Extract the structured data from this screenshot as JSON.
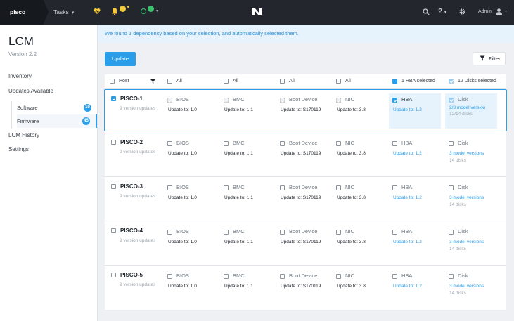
{
  "topbar": {
    "cluster_name": "pisco",
    "tasks_label": "Tasks",
    "help_label": "?",
    "admin_label": "Admin"
  },
  "sidebar": {
    "title": "LCM",
    "version": "Version 2.2",
    "items": [
      {
        "label": "Inventory"
      },
      {
        "label": "Updates Available"
      },
      {
        "label": "LCM History"
      },
      {
        "label": "Settings"
      }
    ],
    "subitems": [
      {
        "label": "Software",
        "badge": "10",
        "active": false
      },
      {
        "label": "Firmware",
        "badge": "45",
        "active": true
      }
    ]
  },
  "banner": {
    "text": "We found 1 dependency based on your selection, and automatically selected them."
  },
  "toolbar": {
    "update_label": "Update",
    "filter_label": "Filter"
  },
  "table": {
    "headers": {
      "host": "Host",
      "bios": "All",
      "bmc": "All",
      "boot": "All",
      "nic": "All",
      "hba": "1 HBA selected",
      "disk": "12 Disks selected"
    },
    "rows": [
      {
        "host": "PISCO-1",
        "sub": "9 version updates",
        "bios": "BIOS",
        "bios_upd": "Update to: 1.0",
        "bmc": "BMC",
        "bmc_upd": "Update to: 1.1",
        "boot": "Boot Device",
        "boot_upd": "Update to: S170119",
        "nic": "NIC",
        "nic_upd": "Update to: 3.8",
        "hba": "HBA",
        "hba_upd": "Update to: 1.2",
        "disk": "Disk",
        "disk_upd": "2/3 model version",
        "disk_count": "12/14 disks"
      },
      {
        "host": "PISCO-2",
        "sub": "9 version updates",
        "bios": "BIOS",
        "bios_upd": "Update to: 1.0",
        "bmc": "BMC",
        "bmc_upd": "Update to: 1.1",
        "boot": "Boot Device",
        "boot_upd": "Update to: S170119",
        "nic": "NIC",
        "nic_upd": "Update to: 3.8",
        "hba": "HBA",
        "hba_upd": "Update to: 1.2",
        "disk": "Disk",
        "disk_upd": "3 model versions",
        "disk_count": "14 disks"
      },
      {
        "host": "PISCO-3",
        "sub": "9 version updates",
        "bios": "BIOS",
        "bios_upd": "Update to: 1.0",
        "bmc": "BMC",
        "bmc_upd": "Update to: 1.1",
        "boot": "Boot Device",
        "boot_upd": "Update to: S170119",
        "nic": "NIC",
        "nic_upd": "Update to: 3.8",
        "hba": "HBA",
        "hba_upd": "Update to: 1.2",
        "disk": "Disk",
        "disk_upd": "3 model versions",
        "disk_count": "14 disks"
      },
      {
        "host": "PISCO-4",
        "sub": "9 version updates",
        "bios": "BIOS",
        "bios_upd": "Update to: 1.0",
        "bmc": "BMC",
        "bmc_upd": "Update to: 1.1",
        "boot": "Boot Device",
        "boot_upd": "Update to: S170119",
        "nic": "NIC",
        "nic_upd": "Update to: 3.8",
        "hba": "HBA",
        "hba_upd": "Update to: 1.2",
        "disk": "Disk",
        "disk_upd": "3 model versions",
        "disk_count": "14 disks"
      },
      {
        "host": "PISCO-5",
        "sub": "9 version updates",
        "bios": "BIOS",
        "bios_upd": "Update to: 1.0",
        "bmc": "BMC",
        "bmc_upd": "Update to: 1.1",
        "boot": "Boot Device",
        "boot_upd": "Update to: S170119",
        "nic": "NIC",
        "nic_upd": "Update to: 3.8",
        "hba": "HBA",
        "hba_upd": "Update to: 1.2",
        "disk": "Disk",
        "disk_upd": "3 model versions",
        "disk_count": "14 disks"
      }
    ]
  },
  "colors": {
    "accent": "#2a9ee8",
    "topbar": "#23272d",
    "status_yellow": "#f3c93b",
    "status_green": "#39c16c"
  }
}
